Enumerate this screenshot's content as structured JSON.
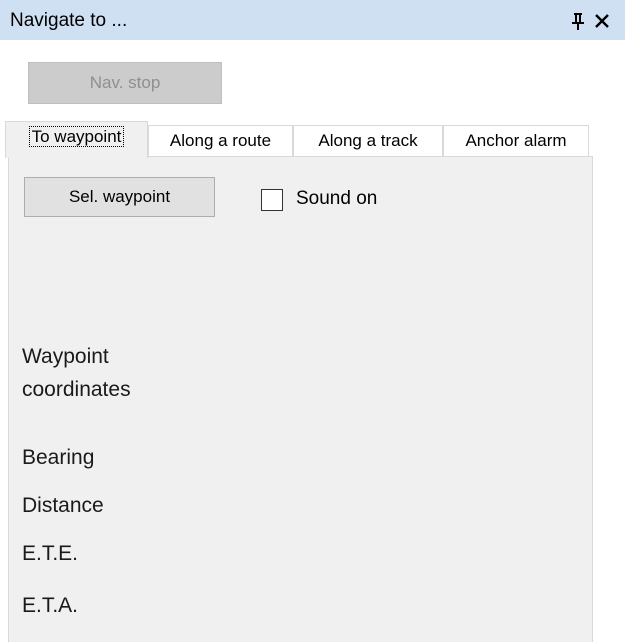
{
  "window": {
    "title": "Navigate to ...",
    "pin_icon": "pin-icon",
    "close_icon": "close-icon"
  },
  "toolbar": {
    "nav_stop_label": "Nav. stop",
    "nav_stop_enabled": false
  },
  "tabs": [
    {
      "label": "To waypoint",
      "active": true
    },
    {
      "label": "Along a route",
      "active": false
    },
    {
      "label": "Along a track",
      "active": false
    },
    {
      "label": "Anchor alarm",
      "active": false
    }
  ],
  "waypoint_tab": {
    "sel_waypoint_label": "Sel. waypoint",
    "sound_on_label": "Sound on",
    "sound_on_checked": false,
    "fields": {
      "coordinates_line1": "Waypoint",
      "coordinates_line2": "coordinates",
      "bearing": "Bearing",
      "distance": "Distance",
      "ete": "E.T.E.",
      "eta": "E.T.A."
    }
  },
  "colors": {
    "titlebar_bg": "#cfe0f3",
    "tab_content_bg": "#f0f0f0",
    "button_bg": "#e1e1e1",
    "disabled_button_bg": "#cccccc"
  }
}
